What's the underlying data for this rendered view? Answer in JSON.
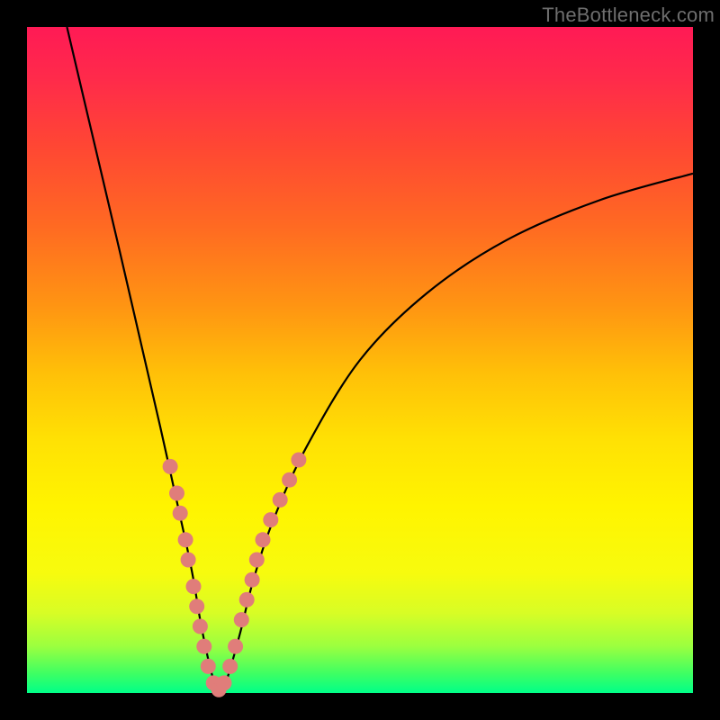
{
  "watermark": "TheBottleneck.com",
  "chart_data": {
    "type": "line",
    "title": "",
    "xlabel": "",
    "ylabel": "",
    "xlim": [
      0,
      100
    ],
    "ylim": [
      0,
      100
    ],
    "grid": false,
    "legend": false,
    "series": [
      {
        "name": "bottleneck-curve",
        "x": [
          6,
          10,
          14,
          17,
          20,
          22,
          24,
          25,
          26,
          27,
          28,
          29,
          30,
          32,
          34,
          37,
          42,
          50,
          60,
          72,
          86,
          100
        ],
        "y": [
          100,
          83,
          66,
          53,
          40,
          31,
          22,
          17,
          11,
          6,
          2,
          0,
          2,
          9,
          17,
          26,
          37,
          50,
          60,
          68,
          74,
          78
        ]
      }
    ],
    "markers": {
      "name": "highlighted-points",
      "points": [
        {
          "x": 21.5,
          "y": 34
        },
        {
          "x": 22.5,
          "y": 30
        },
        {
          "x": 23,
          "y": 27
        },
        {
          "x": 23.8,
          "y": 23
        },
        {
          "x": 24.2,
          "y": 20
        },
        {
          "x": 25,
          "y": 16
        },
        {
          "x": 25.5,
          "y": 13
        },
        {
          "x": 26,
          "y": 10
        },
        {
          "x": 26.6,
          "y": 7
        },
        {
          "x": 27.2,
          "y": 4
        },
        {
          "x": 28,
          "y": 1.5
        },
        {
          "x": 28.8,
          "y": 0.5
        },
        {
          "x": 29.6,
          "y": 1.5
        },
        {
          "x": 30.5,
          "y": 4
        },
        {
          "x": 31.3,
          "y": 7
        },
        {
          "x": 32.2,
          "y": 11
        },
        {
          "x": 33,
          "y": 14
        },
        {
          "x": 33.8,
          "y": 17
        },
        {
          "x": 34.5,
          "y": 20
        },
        {
          "x": 35.4,
          "y": 23
        },
        {
          "x": 36.6,
          "y": 26
        },
        {
          "x": 38,
          "y": 29
        },
        {
          "x": 39.4,
          "y": 32
        },
        {
          "x": 40.8,
          "y": 35
        }
      ]
    }
  }
}
